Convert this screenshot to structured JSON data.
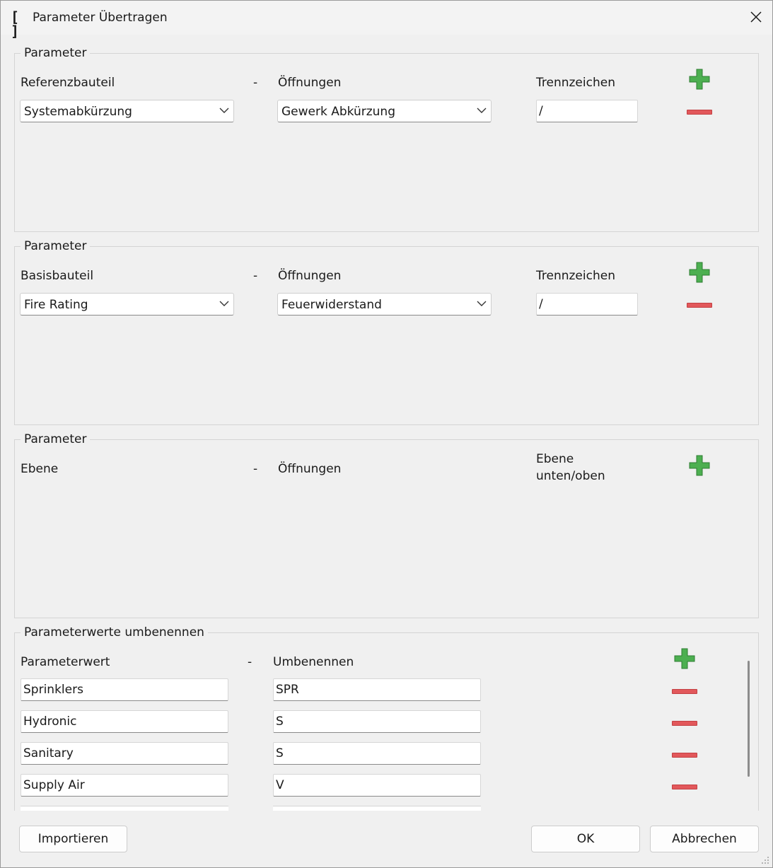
{
  "window": {
    "title": "Parameter Übertragen"
  },
  "groups": [
    {
      "title": "Parameter",
      "col1_label": "Referenzbauteil",
      "dash": "-",
      "col2_label": "Öffnungen",
      "col3_label": "Trennzeichen",
      "row": {
        "combo1": "Systemabkürzung",
        "combo2": "Gewerk Abkürzung",
        "separator": "/"
      }
    },
    {
      "title": "Parameter",
      "col1_label": "Basisbauteil",
      "dash": "-",
      "col2_label": "Öffnungen",
      "col3_label": "Trennzeichen",
      "row": {
        "combo1": "Fire Rating",
        "combo2": "Feuerwiderstand",
        "separator": "/"
      }
    },
    {
      "title": "Parameter",
      "col1_label": "Ebene",
      "dash": "-",
      "col2_label": "Öffnungen",
      "col3_label_line1": "Ebene",
      "col3_label_line2": "unten/oben"
    }
  ],
  "rename": {
    "title": "Parameterwerte umbenennen",
    "col1_label": "Parameterwert",
    "dash": "-",
    "col2_label": "Umbenennen",
    "rows": [
      {
        "value": "Sprinklers",
        "rename": "SPR"
      },
      {
        "value": "Hydronic",
        "rename": "S"
      },
      {
        "value": "Sanitary",
        "rename": "S"
      },
      {
        "value": "Supply Air",
        "rename": "V"
      }
    ]
  },
  "buttons": {
    "import": "Importieren",
    "ok": "OK",
    "cancel": "Abbrechen"
  },
  "colors": {
    "plus": "#4caf50",
    "minus": "#e2585b"
  },
  "icons": {
    "app": "bracket-logo-icon",
    "close": "close-icon",
    "add": "plus-icon",
    "remove": "minus-icon",
    "dropdown": "chevron-down-icon"
  }
}
